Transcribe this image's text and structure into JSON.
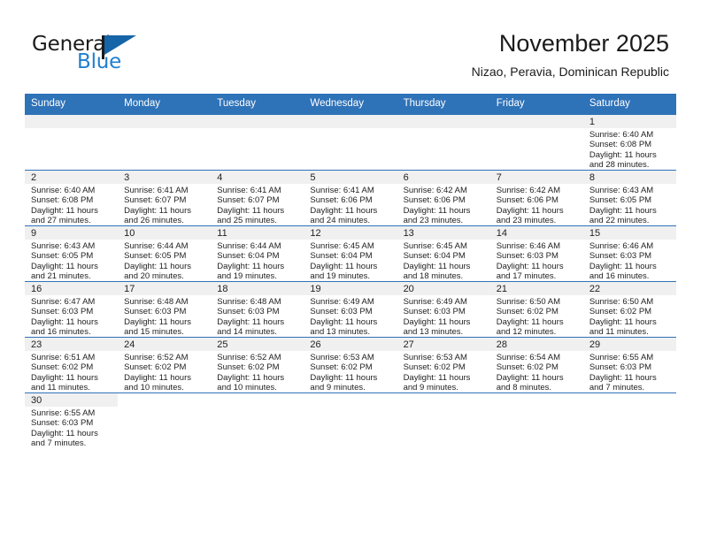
{
  "brand": {
    "name_part1": "General",
    "name_part2": "Blue",
    "accent_color": "#1f7fd0",
    "flag_color": "#1565a8"
  },
  "header": {
    "title": "November 2025",
    "subtitle": "Nizao, Peravia, Dominican Republic"
  },
  "calendar": {
    "header_color": "#2e72b8",
    "daynum_band_color": "#f0f0f0",
    "weekday_headers": [
      "Sunday",
      "Monday",
      "Tuesday",
      "Wednesday",
      "Thursday",
      "Friday",
      "Saturday"
    ],
    "weeks": [
      [
        {
          "day": "",
          "lines": [],
          "blank": true
        },
        {
          "day": "",
          "lines": [],
          "blank": true
        },
        {
          "day": "",
          "lines": [],
          "blank": true
        },
        {
          "day": "",
          "lines": [],
          "blank": true
        },
        {
          "day": "",
          "lines": [],
          "blank": true
        },
        {
          "day": "",
          "lines": [],
          "blank": true
        },
        {
          "day": "1",
          "lines": [
            "Sunrise: 6:40 AM",
            "Sunset: 6:08 PM",
            "Daylight: 11 hours",
            "and 28 minutes."
          ]
        }
      ],
      [
        {
          "day": "2",
          "lines": [
            "Sunrise: 6:40 AM",
            "Sunset: 6:08 PM",
            "Daylight: 11 hours",
            "and 27 minutes."
          ]
        },
        {
          "day": "3",
          "lines": [
            "Sunrise: 6:41 AM",
            "Sunset: 6:07 PM",
            "Daylight: 11 hours",
            "and 26 minutes."
          ]
        },
        {
          "day": "4",
          "lines": [
            "Sunrise: 6:41 AM",
            "Sunset: 6:07 PM",
            "Daylight: 11 hours",
            "and 25 minutes."
          ]
        },
        {
          "day": "5",
          "lines": [
            "Sunrise: 6:41 AM",
            "Sunset: 6:06 PM",
            "Daylight: 11 hours",
            "and 24 minutes."
          ]
        },
        {
          "day": "6",
          "lines": [
            "Sunrise: 6:42 AM",
            "Sunset: 6:06 PM",
            "Daylight: 11 hours",
            "and 23 minutes."
          ]
        },
        {
          "day": "7",
          "lines": [
            "Sunrise: 6:42 AM",
            "Sunset: 6:06 PM",
            "Daylight: 11 hours",
            "and 23 minutes."
          ]
        },
        {
          "day": "8",
          "lines": [
            "Sunrise: 6:43 AM",
            "Sunset: 6:05 PM",
            "Daylight: 11 hours",
            "and 22 minutes."
          ]
        }
      ],
      [
        {
          "day": "9",
          "lines": [
            "Sunrise: 6:43 AM",
            "Sunset: 6:05 PM",
            "Daylight: 11 hours",
            "and 21 minutes."
          ]
        },
        {
          "day": "10",
          "lines": [
            "Sunrise: 6:44 AM",
            "Sunset: 6:05 PM",
            "Daylight: 11 hours",
            "and 20 minutes."
          ]
        },
        {
          "day": "11",
          "lines": [
            "Sunrise: 6:44 AM",
            "Sunset: 6:04 PM",
            "Daylight: 11 hours",
            "and 19 minutes."
          ]
        },
        {
          "day": "12",
          "lines": [
            "Sunrise: 6:45 AM",
            "Sunset: 6:04 PM",
            "Daylight: 11 hours",
            "and 19 minutes."
          ]
        },
        {
          "day": "13",
          "lines": [
            "Sunrise: 6:45 AM",
            "Sunset: 6:04 PM",
            "Daylight: 11 hours",
            "and 18 minutes."
          ]
        },
        {
          "day": "14",
          "lines": [
            "Sunrise: 6:46 AM",
            "Sunset: 6:03 PM",
            "Daylight: 11 hours",
            "and 17 minutes."
          ]
        },
        {
          "day": "15",
          "lines": [
            "Sunrise: 6:46 AM",
            "Sunset: 6:03 PM",
            "Daylight: 11 hours",
            "and 16 minutes."
          ]
        }
      ],
      [
        {
          "day": "16",
          "lines": [
            "Sunrise: 6:47 AM",
            "Sunset: 6:03 PM",
            "Daylight: 11 hours",
            "and 16 minutes."
          ]
        },
        {
          "day": "17",
          "lines": [
            "Sunrise: 6:48 AM",
            "Sunset: 6:03 PM",
            "Daylight: 11 hours",
            "and 15 minutes."
          ]
        },
        {
          "day": "18",
          "lines": [
            "Sunrise: 6:48 AM",
            "Sunset: 6:03 PM",
            "Daylight: 11 hours",
            "and 14 minutes."
          ]
        },
        {
          "day": "19",
          "lines": [
            "Sunrise: 6:49 AM",
            "Sunset: 6:03 PM",
            "Daylight: 11 hours",
            "and 13 minutes."
          ]
        },
        {
          "day": "20",
          "lines": [
            "Sunrise: 6:49 AM",
            "Sunset: 6:03 PM",
            "Daylight: 11 hours",
            "and 13 minutes."
          ]
        },
        {
          "day": "21",
          "lines": [
            "Sunrise: 6:50 AM",
            "Sunset: 6:02 PM",
            "Daylight: 11 hours",
            "and 12 minutes."
          ]
        },
        {
          "day": "22",
          "lines": [
            "Sunrise: 6:50 AM",
            "Sunset: 6:02 PM",
            "Daylight: 11 hours",
            "and 11 minutes."
          ]
        }
      ],
      [
        {
          "day": "23",
          "lines": [
            "Sunrise: 6:51 AM",
            "Sunset: 6:02 PM",
            "Daylight: 11 hours",
            "and 11 minutes."
          ]
        },
        {
          "day": "24",
          "lines": [
            "Sunrise: 6:52 AM",
            "Sunset: 6:02 PM",
            "Daylight: 11 hours",
            "and 10 minutes."
          ]
        },
        {
          "day": "25",
          "lines": [
            "Sunrise: 6:52 AM",
            "Sunset: 6:02 PM",
            "Daylight: 11 hours",
            "and 10 minutes."
          ]
        },
        {
          "day": "26",
          "lines": [
            "Sunrise: 6:53 AM",
            "Sunset: 6:02 PM",
            "Daylight: 11 hours",
            "and 9 minutes."
          ]
        },
        {
          "day": "27",
          "lines": [
            "Sunrise: 6:53 AM",
            "Sunset: 6:02 PM",
            "Daylight: 11 hours",
            "and 9 minutes."
          ]
        },
        {
          "day": "28",
          "lines": [
            "Sunrise: 6:54 AM",
            "Sunset: 6:02 PM",
            "Daylight: 11 hours",
            "and 8 minutes."
          ]
        },
        {
          "day": "29",
          "lines": [
            "Sunrise: 6:55 AM",
            "Sunset: 6:03 PM",
            "Daylight: 11 hours",
            "and 7 minutes."
          ]
        }
      ],
      [
        {
          "day": "30",
          "lines": [
            "Sunrise: 6:55 AM",
            "Sunset: 6:03 PM",
            "Daylight: 11 hours",
            "and 7 minutes."
          ]
        },
        {
          "day": "",
          "lines": [],
          "blank": true
        },
        {
          "day": "",
          "lines": [],
          "blank": true
        },
        {
          "day": "",
          "lines": [],
          "blank": true
        },
        {
          "day": "",
          "lines": [],
          "blank": true
        },
        {
          "day": "",
          "lines": [],
          "blank": true
        },
        {
          "day": "",
          "lines": [],
          "blank": true
        }
      ]
    ]
  }
}
